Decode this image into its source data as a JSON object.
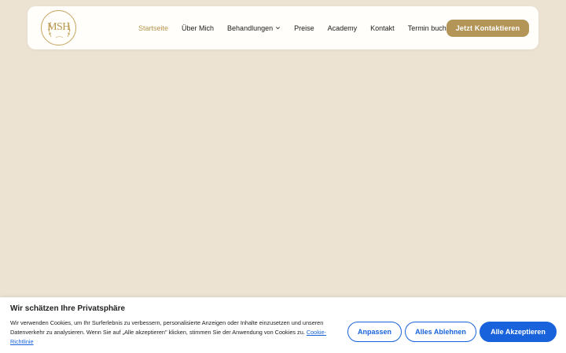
{
  "header": {
    "logo_text": "MSH",
    "nav": [
      {
        "label": "Startseite",
        "active": true
      },
      {
        "label": "Über Mich"
      },
      {
        "label": "Behandlungen",
        "has_dropdown": true
      },
      {
        "label": "Preise"
      },
      {
        "label": "Academy"
      },
      {
        "label": "Kontakt"
      },
      {
        "label": "Termin buchen"
      }
    ],
    "cta_label": "Jetzt Kontaktieren"
  },
  "cookie_banner": {
    "title": "Wir schätzen Ihre Privatsphäre",
    "text": "Wir verwenden Cookies, um Ihr Surferlebnis zu verbessern, personalisierte Anzeigen oder Inhalte einzusetzen und unseren Datenverkehr zu analysieren. Wenn Sie auf „Alle akzeptieren\" klicken, stimmen Sie der Anwendung von Cookies zu.",
    "link_label": "Cookie-Richtlinie",
    "buttons": {
      "customize": "Anpassen",
      "reject": "Alles Ablehnen",
      "accept": "Alle Akzeptieren"
    }
  },
  "colors": {
    "background": "#ece3d2",
    "gold": "#b49558",
    "active_nav": "#b8974f",
    "cookie_blue": "#1863dc"
  }
}
